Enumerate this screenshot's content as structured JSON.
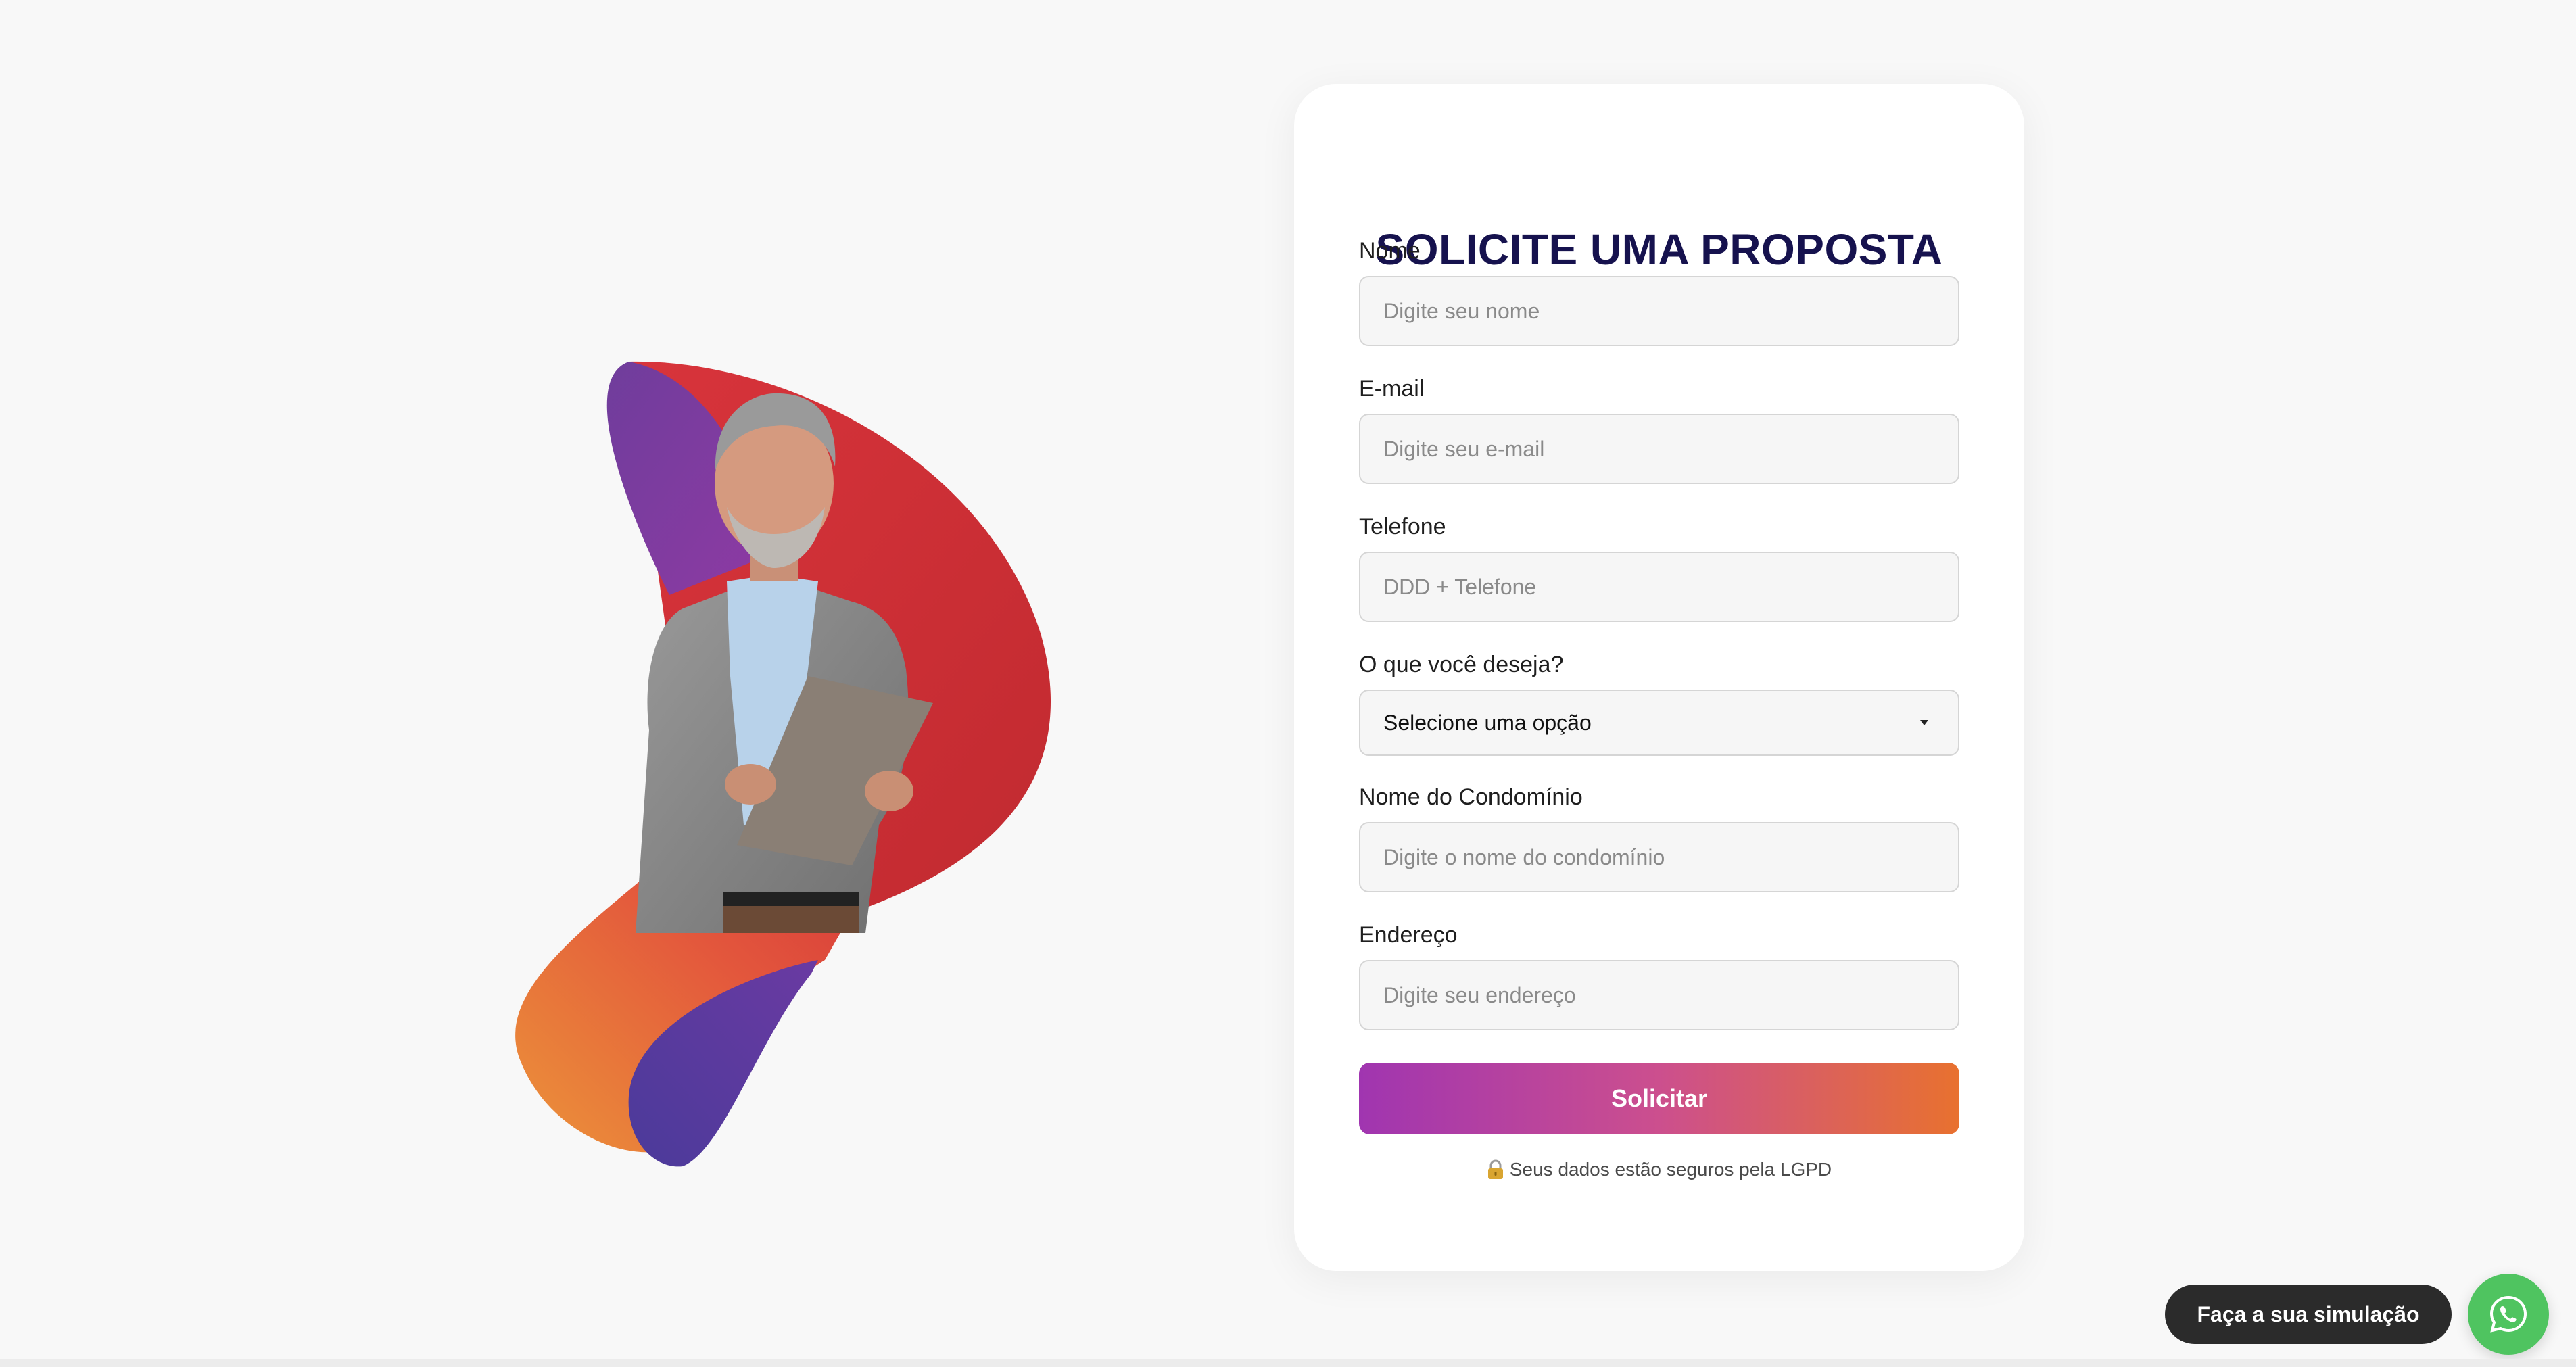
{
  "form": {
    "title": "SOLICITE UMA PROPOSTA",
    "fields": [
      {
        "label": "Nome",
        "placeholder": "Digite seu nome"
      },
      {
        "label": "E-mail",
        "placeholder": "Digite seu e-mail"
      },
      {
        "label": "Telefone",
        "placeholder": "DDD + Telefone"
      },
      {
        "label": "O que você deseja?",
        "selected": "Selecione uma opção"
      },
      {
        "label": "Nome do Condomínio",
        "placeholder": "Digite o nome do condomínio"
      },
      {
        "label": "Endereço",
        "placeholder": "Digite seu endereço"
      }
    ],
    "submit_label": "Solicitar",
    "privacy_text": "Seus dados estão seguros pela LGPD"
  },
  "floating": {
    "simulation_label": "Faça a sua simulação",
    "icon": "whatsapp-icon"
  },
  "icons": {
    "privacy": "lock-icon",
    "select": "chevron-down-icon"
  },
  "colors": {
    "title": "#16124e",
    "button_gradient": [
      "#a035b0",
      "#cc4f8e",
      "#e8712f"
    ],
    "whatsapp": "#4fc460",
    "blob_purple": "#7a3fa0",
    "blob_red": "#c82f32",
    "blob_orange": "#e98a37"
  }
}
